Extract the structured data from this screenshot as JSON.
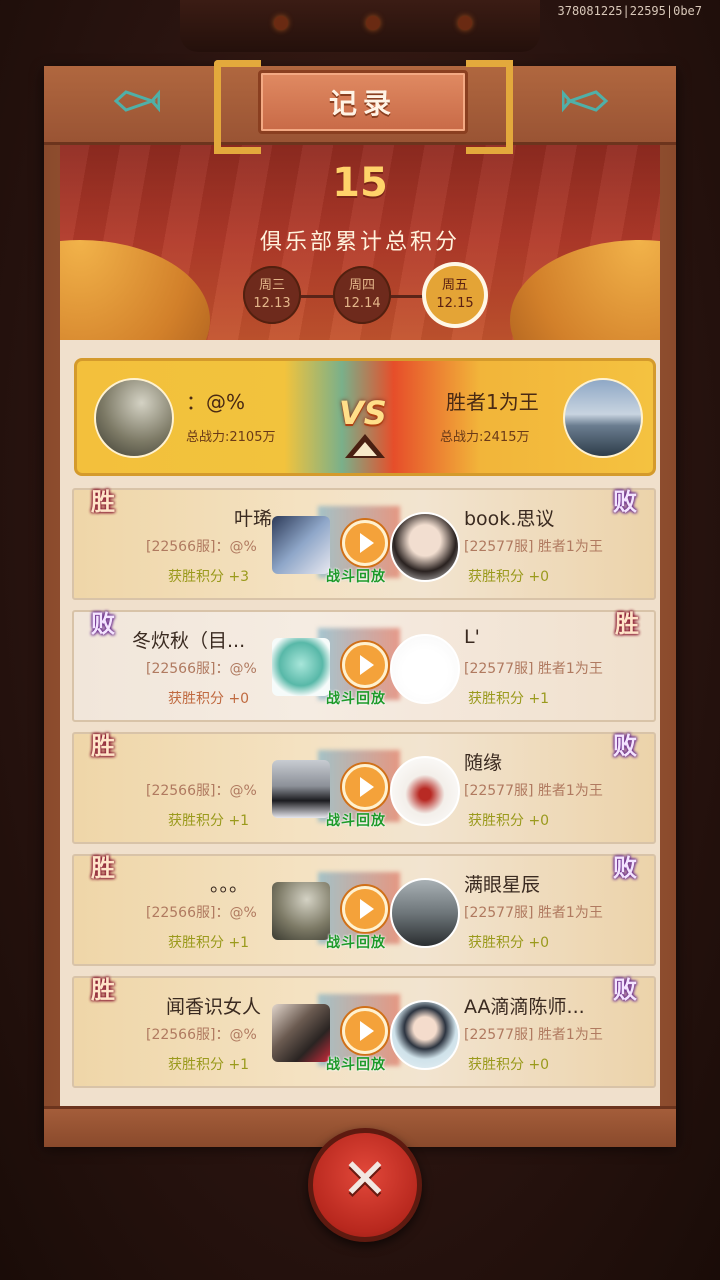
{
  "top_id": "378081225|22595|0be7",
  "title": "记录",
  "score": "15",
  "score_label": "俱乐部累计总积分",
  "days": [
    {
      "label": "周三",
      "date": "12.13",
      "active": false
    },
    {
      "label": "周四",
      "date": "12.14",
      "active": false
    },
    {
      "label": "周五",
      "date": "12.15",
      "active": true
    }
  ],
  "vs": {
    "left_name": "：@%",
    "left_power": "总战力:2105万",
    "vs_label": "VS",
    "right_name": "胜者1为王",
    "right_power": "总战力:2415万"
  },
  "replay_label": "战斗回放",
  "matches": [
    {
      "result": "win",
      "left_badge": "胜",
      "right_badge": "败",
      "left_name": "叶琋",
      "left_server": "[22566服]：@%",
      "left_points": "获胜积分 +3",
      "right_name": "book.思议",
      "right_server": "[22577服] 胜者1为王",
      "right_points": "获胜积分 +0"
    },
    {
      "result": "lose",
      "left_badge": "败",
      "right_badge": "胜",
      "left_name": "冬炊秋（目...",
      "left_server": "[22566服]：@%",
      "left_points": "获胜积分 +0",
      "right_name": "L'",
      "right_server": "[22577服] 胜者1为王",
      "right_points": "获胜积分 +1"
    },
    {
      "result": "win",
      "left_badge": "胜",
      "right_badge": "败",
      "left_name": "",
      "left_server": "[22566服]：@%",
      "left_points": "获胜积分 +1",
      "right_name": "随缘",
      "right_server": "[22577服] 胜者1为王",
      "right_points": "获胜积分 +0"
    },
    {
      "result": "win",
      "left_badge": "胜",
      "right_badge": "败",
      "left_name": "。。。",
      "left_server": "[22566服]：@%",
      "left_points": "获胜积分 +1",
      "right_name": "满眼星辰",
      "right_server": "[22577服] 胜者1为王",
      "right_points": "获胜积分 +0"
    },
    {
      "result": "win",
      "left_badge": "胜",
      "right_badge": "败",
      "left_name": "闻香识女人",
      "left_server": "[22566服]：@%",
      "left_points": "获胜积分 +1",
      "right_name": "AA滴滴陈师...",
      "right_server": "[22577服] 胜者1为王",
      "right_points": "获胜积分 +0"
    }
  ],
  "close_icon": "close-x-icon"
}
